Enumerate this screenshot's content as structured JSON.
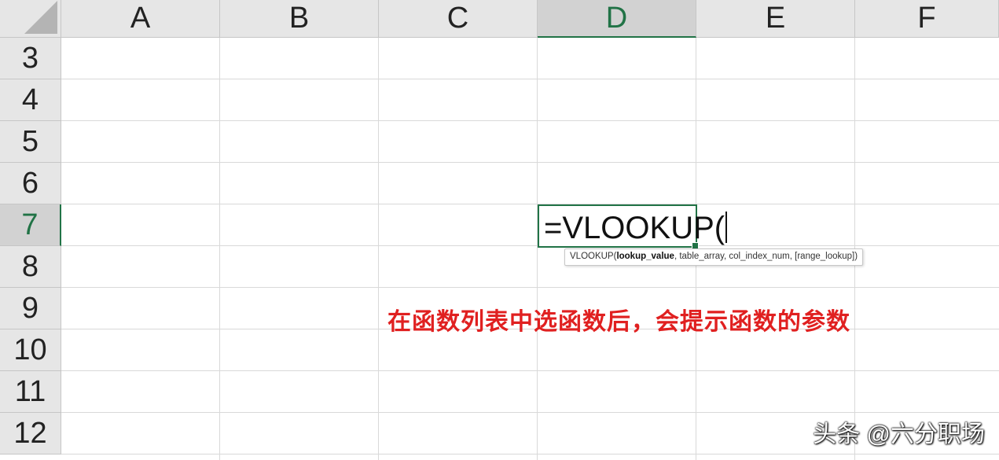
{
  "columns": [
    {
      "label": "A",
      "selected": false
    },
    {
      "label": "B",
      "selected": false
    },
    {
      "label": "C",
      "selected": false
    },
    {
      "label": "D",
      "selected": true
    },
    {
      "label": "E",
      "selected": false
    },
    {
      "label": "F",
      "selected": false
    }
  ],
  "rows": [
    {
      "label": "3",
      "selected": false
    },
    {
      "label": "4",
      "selected": false
    },
    {
      "label": "5",
      "selected": false
    },
    {
      "label": "6",
      "selected": false
    },
    {
      "label": "7",
      "selected": true
    },
    {
      "label": "8",
      "selected": false
    },
    {
      "label": "9",
      "selected": false
    },
    {
      "label": "10",
      "selected": false
    },
    {
      "label": "11",
      "selected": false
    },
    {
      "label": "12",
      "selected": false
    }
  ],
  "active_cell": {
    "formula": "=VLOOKUP("
  },
  "tooltip": {
    "func": "VLOOKUP(",
    "arg_current": "lookup_value",
    "rest": ", table_array, col_index_num, [range_lookup])"
  },
  "annotation": "在函数列表中选函数后，会提示函数的参数",
  "watermark": "头条 @六分职场",
  "colors": {
    "accent": "#217346",
    "annotation": "#e02020",
    "header_bg": "#e6e6e6",
    "gridline": "#d9d9d9"
  }
}
